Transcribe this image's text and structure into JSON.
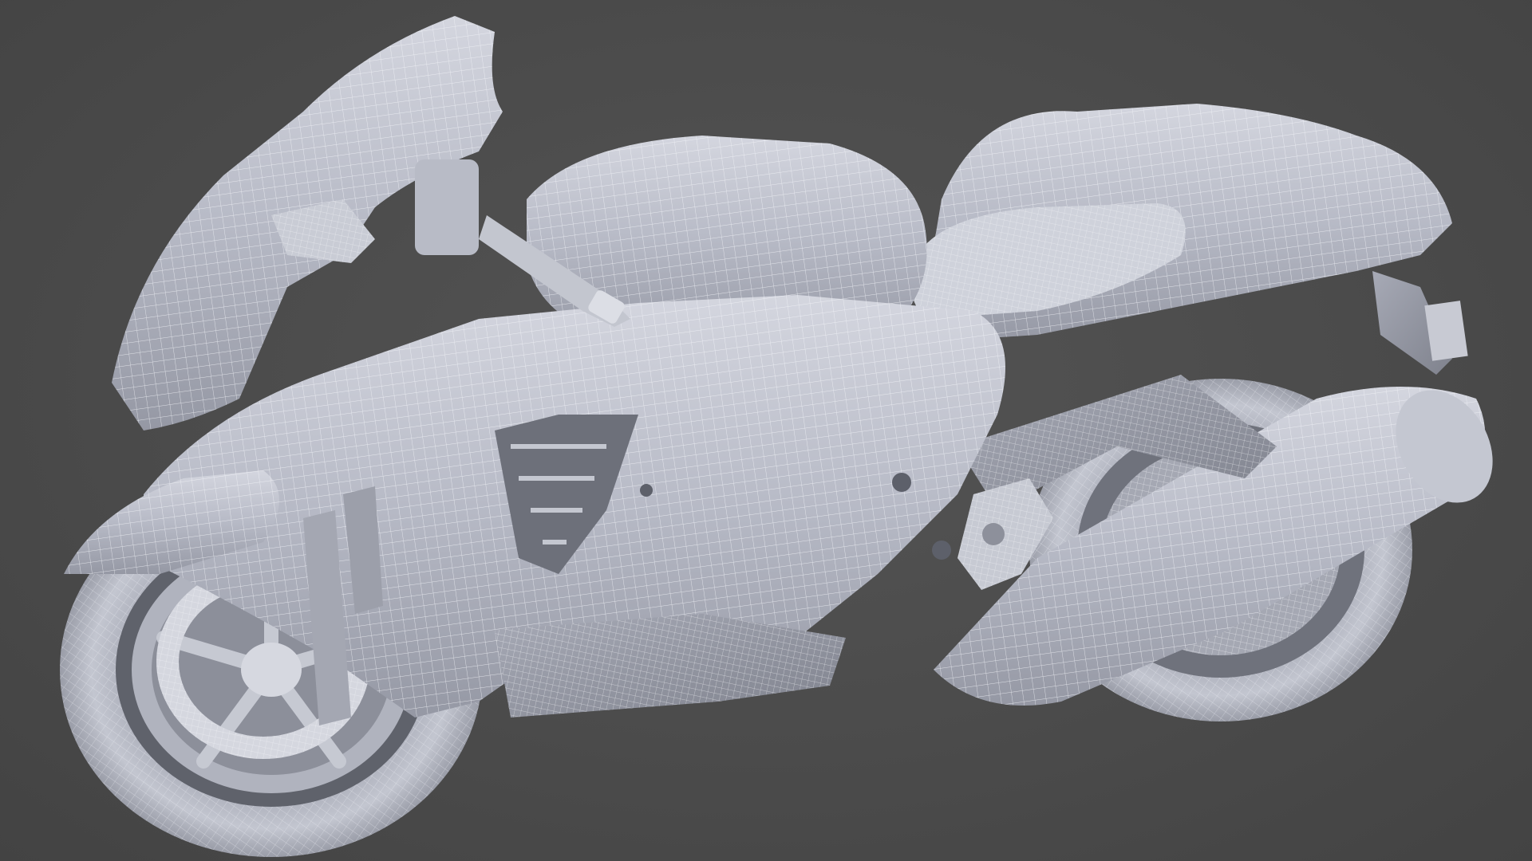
{
  "scene": {
    "subject_icon": "motorcycle-icon",
    "colors": {
      "background": "#4a4a4a",
      "model_base": "#b9bcc8",
      "model_light": "#dcdee6",
      "model_shadow": "#8e919c",
      "wire": "#f2f3f7"
    }
  }
}
